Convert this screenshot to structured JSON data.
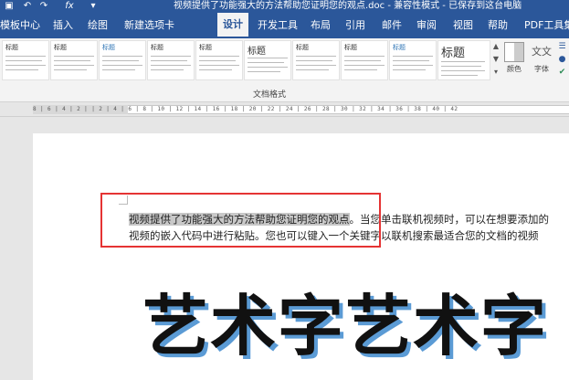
{
  "window": {
    "title": "视频提供了功能强大的方法帮助您证明您的观点.doc - 兼容性模式 - 已保存到这台电脑",
    "quick_access": [
      "save-icon",
      "undo-icon",
      "redo-icon",
      "formula-icon",
      "customize-icon"
    ]
  },
  "tabs": [
    "模板中心",
    "插入",
    "绘图",
    "新建选项卡",
    "设计",
    "开发工具",
    "布局",
    "引用",
    "邮件",
    "审阅",
    "视图",
    "帮助",
    "PDF工具集"
  ],
  "active_tab": "设计",
  "ribbon": {
    "style_gallery": [
      "标题",
      "标题",
      "标题",
      "标题",
      "标题",
      "标题",
      "标题",
      "标题",
      "标题",
      "标题",
      "标题"
    ],
    "colors_label": "颜色",
    "fonts_label": "字体",
    "fonts_glyph": "文文",
    "group_label": "文档格式"
  },
  "ruler": {
    "text": "8 | 6 | 4 | 2 |   | 2 | 4 | 6 | 8 | 10 | 12 | 14 | 16 | 18 | 20 | 22 | 24 | 26 | 28 | 30 | 32 | 34 | 36 | 38 | 40 | 42"
  },
  "document": {
    "line1_selected": "视频提供了功能强大的方法帮助您证明您的观点",
    "line1_rest": "。当您单击联机视频时，可以在想要添加的",
    "line2": "视频的嵌入代码中进行粘贴。您也可以键入一个关键字以联机搜索最适合您的文档的视频",
    "wordart": "艺术字艺术字"
  },
  "colors": {
    "brand": "#2b579a",
    "highlight": "#c8c8c8",
    "annotation": "#e53333",
    "wordart_shadow": "#5b9bd5"
  }
}
